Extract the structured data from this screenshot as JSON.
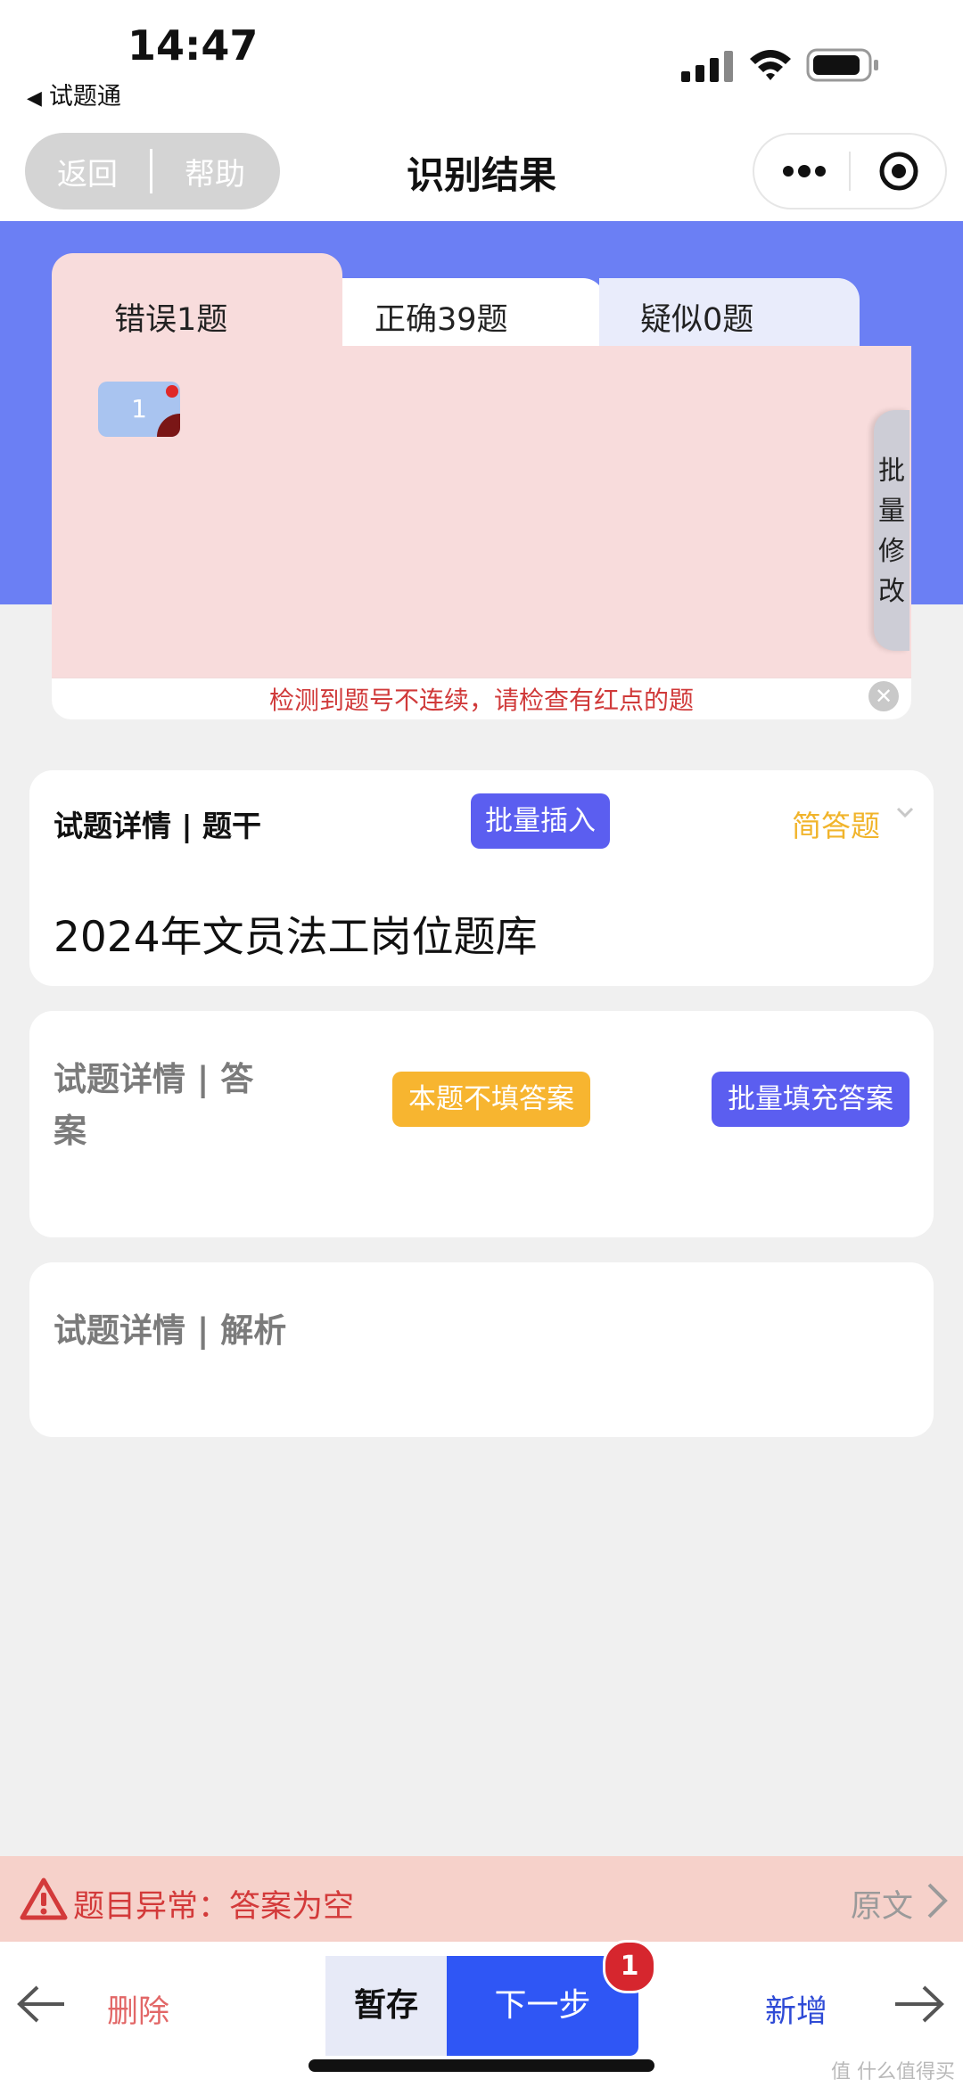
{
  "status_bar": {
    "time": "14:47",
    "back_app": "试题通"
  },
  "nav": {
    "back": "返回",
    "help": "帮助",
    "title": "识别结果"
  },
  "tabs": [
    {
      "label": "错误1题"
    },
    {
      "label": "正确39题"
    },
    {
      "label": "疑似0题"
    }
  ],
  "error_panel": {
    "question_chip": "1",
    "batch_edit": "批\n量\n修\n改",
    "warning": "检测到题号不连续，请检查有红点的题"
  },
  "stem_card": {
    "title": "试题详情 | 题干",
    "batch_insert": "批量插入",
    "question_type": "简答题",
    "stem": "2024年文员法工岗位题库"
  },
  "answer_card": {
    "title": "试题详情 | 答案",
    "no_answer": "本题不填答案",
    "batch_fill": "批量填充答案"
  },
  "analysis_card": {
    "title": "试题详情 | 解析"
  },
  "error_bar": {
    "message": "题目异常：答案为空",
    "original": "原文"
  },
  "toolbar": {
    "delete": "删除",
    "save": "暂存",
    "next": "下一步",
    "next_badge": "1",
    "add": "新增"
  },
  "watermark": "值 什么值得买",
  "colors": {
    "accent": "#6b7ff4",
    "primary_button": "#5b5ef0",
    "next_button": "#2f56f5",
    "warning_red": "#d33a3a",
    "answer_type": "#f1b42b"
  }
}
